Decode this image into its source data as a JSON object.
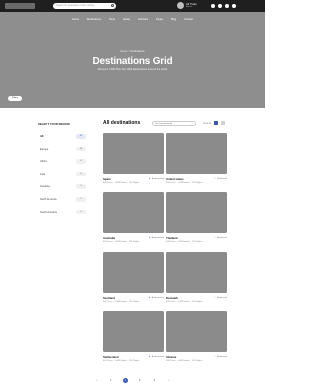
{
  "topbar": {
    "search_placeholder": "Search for destination, hotel, activity",
    "user_name": "Ali Tufan",
    "user_role": "Admin"
  },
  "nav": [
    "Home",
    "Destinations",
    "Tours",
    "Hotels",
    "Activities",
    "Pages",
    "Blog",
    "Contact"
  ],
  "hero": {
    "breadcrumb": "Home > Destinations",
    "title": "Destinations Grid",
    "subtitle": "Discover 1,000 Plus Top 1000 Destinations around the world",
    "filter_button": "Filters"
  },
  "sidebar": {
    "title": "SELECT YOUR REGION",
    "regions": [
      {
        "name": "All",
        "count": "32",
        "active": true
      },
      {
        "name": "Europe",
        "count": "12",
        "active": false
      },
      {
        "name": "Africa",
        "count": "8",
        "active": false
      },
      {
        "name": "Asia",
        "count": "6",
        "active": false
      },
      {
        "name": "Oceania",
        "count": "3",
        "active": false
      },
      {
        "name": "North America",
        "count": "2",
        "active": false
      },
      {
        "name": "South America",
        "count": "1",
        "active": false
      }
    ]
  },
  "main": {
    "title": "All destinations",
    "sort_label": "Sort by popularity",
    "view_label": "View as"
  },
  "destinations": [
    {
      "name": "Spain",
      "bookmark": "Bookmarked",
      "meta": "845 Tours · 1,849 Hotels · 124 Flights"
    },
    {
      "name": "United states",
      "bookmark": "Bookmark",
      "meta": "845 Tours · 1,849 Hotels · 124 Flights"
    },
    {
      "name": "Australia",
      "bookmark": "Bookmarked",
      "meta": "845 Tours · 1,849 Hotels · 124 Flights"
    },
    {
      "name": "Thailand",
      "bookmark": "Bookmark",
      "meta": "845 Tours · 1,849 Hotels · 124 Flights"
    },
    {
      "name": "Scotland",
      "bookmark": "Bookmarked",
      "meta": "845 Tours · 1,849 Hotels · 124 Flights"
    },
    {
      "name": "Denmark",
      "bookmark": "Bookmark",
      "meta": "845 Tours · 1,849 Hotels · 124 Flights"
    },
    {
      "name": "Switzerland",
      "bookmark": "Bookmarked",
      "meta": "845 Tours · 1,849 Hotels · 124 Flights"
    },
    {
      "name": "Ukraine",
      "bookmark": "Bookmark",
      "meta": "845 Tours · 1,849 Hotels · 124 Flights"
    }
  ],
  "pagination": {
    "prev": "‹",
    "pages": [
      "1",
      "2",
      "3",
      "4"
    ],
    "current": "2",
    "next": "›"
  },
  "colors": {
    "accent": "#3d56b2",
    "hero_bg": "#8e8e8e",
    "topbar_bg": "#1f1f1f"
  }
}
